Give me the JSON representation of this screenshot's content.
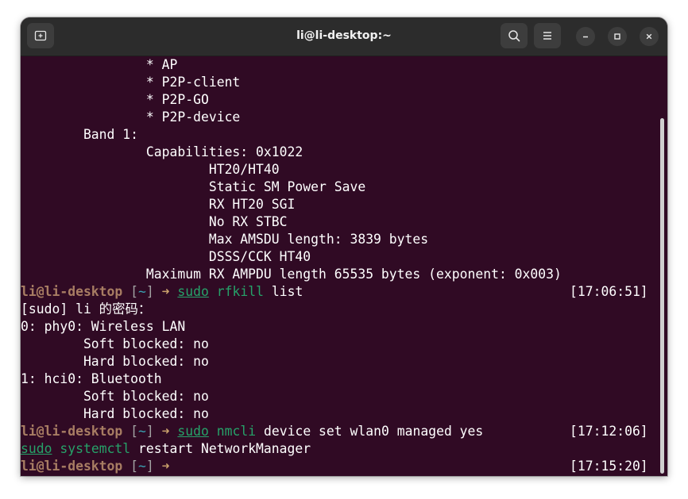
{
  "window": {
    "title": "li@li-desktop:~"
  },
  "icons": {
    "new_tab": "new-tab-icon",
    "search": "search-icon",
    "menu": "hamburger-menu-icon",
    "minimize": "minimize-icon",
    "maximize": "maximize-icon",
    "close": "close-icon"
  },
  "colors": {
    "terminal_bg": "#300a24",
    "titlebar_bg": "#2c2c2c",
    "prompt_user": "#a87d63",
    "command": "#26a269",
    "tilde": "#3aa4b4",
    "arrow": "#c9a06b"
  },
  "terminal": {
    "output_top": [
      "                * AP",
      "                * P2P-client",
      "                * P2P-GO",
      "                * P2P-device",
      "        Band 1:",
      "                Capabilities: 0x1022",
      "                        HT20/HT40",
      "                        Static SM Power Save",
      "                        RX HT20 SGI",
      "                        No RX STBC",
      "                        Max AMSDU length: 3839 bytes",
      "                        DSSS/CCK HT40",
      "                Maximum RX AMPDU length 65535 bytes (exponent: 0x003)"
    ],
    "prompt": {
      "user_host": "li@li-desktop",
      "dir_open": " [",
      "dir": "~",
      "dir_close": "]",
      "arrow": " ➜ "
    },
    "cmd1": {
      "sudo": "sudo",
      "program": "rfkill",
      "args": " list",
      "timestamp": "[17:06:51]"
    },
    "output_mid": [
      "[sudo] li 的密码：",
      "0: phy0: Wireless LAN",
      "        Soft blocked: no",
      "        Hard blocked: no",
      "1: hci0: Bluetooth",
      "        Soft blocked: no",
      "        Hard blocked: no"
    ],
    "cmd2": {
      "sudo": "sudo",
      "program": "nmcli",
      "args": " device set wlan0 managed yes",
      "timestamp": "[17:12:06]"
    },
    "cmd2_cont": {
      "sudo": "sudo",
      "program": "systemctl",
      "args": " restart NetworkManager"
    },
    "cmd3": {
      "timestamp": "[17:15:20]"
    }
  }
}
